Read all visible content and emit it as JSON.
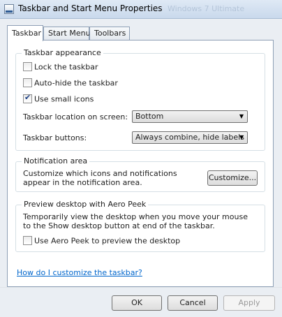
{
  "window": {
    "title": "Taskbar and Start Menu Properties",
    "ghost_text": "Windows 7 Ultimate"
  },
  "tabs": [
    {
      "label": "Taskbar",
      "active": true
    },
    {
      "label": "Start Menu",
      "active": false
    },
    {
      "label": "Toolbars",
      "active": false
    }
  ],
  "appearance": {
    "title": "Taskbar appearance",
    "lock": {
      "label": "Lock the taskbar",
      "checked": false
    },
    "autohide": {
      "label": "Auto-hide the taskbar",
      "checked": false
    },
    "small_icons": {
      "label": "Use small icons",
      "checked": true
    },
    "location": {
      "label": "Taskbar location on screen:",
      "value": "Bottom"
    },
    "buttons": {
      "label": "Taskbar buttons:",
      "value": "Always combine, hide labels"
    }
  },
  "notification": {
    "title": "Notification area",
    "text": "Customize which icons and notifications appear in the notification area.",
    "customize_label": "Customize..."
  },
  "peek": {
    "title": "Preview desktop with Aero Peek",
    "text": "Temporarily view the desktop when you move your mouse to the Show desktop button at end of the taskbar.",
    "checkbox": {
      "label": "Use Aero Peek to preview the desktop",
      "checked": false
    }
  },
  "help_link": "How do I customize the taskbar?",
  "footer": {
    "ok": "OK",
    "cancel": "Cancel",
    "apply": "Apply"
  },
  "colors": {
    "link": "#0066cc",
    "title_bar": "#c9d9ec",
    "panel_border": "#8e9fb5"
  }
}
